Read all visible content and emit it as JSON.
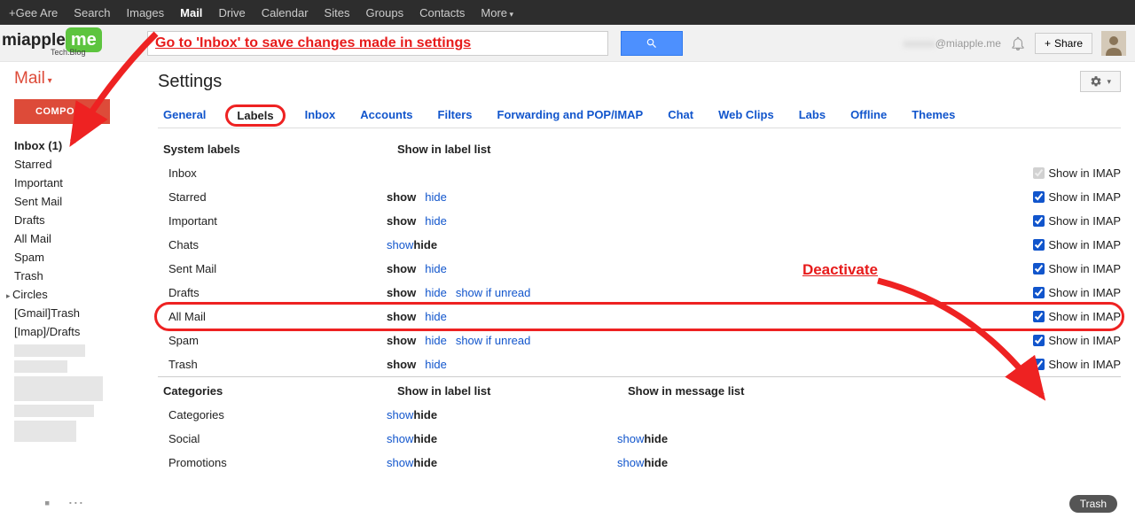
{
  "top_nav": {
    "items": [
      "+Gee Are",
      "Search",
      "Images",
      "Mail",
      "Drive",
      "Calendar",
      "Sites",
      "Groups",
      "Contacts",
      "More"
    ],
    "active_idx": 3
  },
  "logo": {
    "main": "miapple",
    "suffix": "me",
    "sub": "Tech.Blog"
  },
  "search": {
    "annotation": "Go to 'Inbox' to save changes made in settings"
  },
  "header": {
    "email_suffix": "@miapple.me",
    "share": "Share"
  },
  "sidebar": {
    "mail": "Mail",
    "compose": "COMPOSE",
    "items": [
      "Inbox (1)",
      "Starred",
      "Important",
      "Sent Mail",
      "Drafts",
      "All Mail",
      "Spam",
      "Trash",
      "Circles",
      "[Gmail]Trash",
      "[Imap]/Drafts"
    ]
  },
  "content": {
    "title": "Settings",
    "tabs": [
      "General",
      "Labels",
      "Inbox",
      "Accounts",
      "Filters",
      "Forwarding and POP/IMAP",
      "Chat",
      "Web Clips",
      "Labs",
      "Offline",
      "Themes"
    ],
    "active_tab_idx": 1,
    "section1": {
      "head_label": "System labels",
      "head_show": "Show in label list",
      "rows": [
        {
          "name": "Inbox",
          "showlist": [],
          "imap": true,
          "imap_disabled": true
        },
        {
          "name": "Starred",
          "showlist": [
            [
              "show",
              true
            ],
            [
              "hide",
              false
            ]
          ],
          "imap": true
        },
        {
          "name": "Important",
          "showlist": [
            [
              "show",
              true
            ],
            [
              "hide",
              false
            ]
          ],
          "imap": true
        },
        {
          "name": "Chats",
          "showlist": [
            [
              "show",
              false
            ],
            [
              "hide",
              true
            ]
          ],
          "imap": true
        },
        {
          "name": "Sent Mail",
          "showlist": [
            [
              "show",
              true
            ],
            [
              "hide",
              false
            ]
          ],
          "imap": true
        },
        {
          "name": "Drafts",
          "showlist": [
            [
              "show",
              true
            ],
            [
              "hide",
              false
            ],
            [
              "show if unread",
              false
            ]
          ],
          "imap": true
        },
        {
          "name": "All Mail",
          "showlist": [
            [
              "show",
              true
            ],
            [
              "hide",
              false
            ]
          ],
          "imap": true,
          "oval": true
        },
        {
          "name": "Spam",
          "showlist": [
            [
              "show",
              true
            ],
            [
              "hide",
              false
            ],
            [
              "show if unread",
              false
            ]
          ],
          "imap": true
        },
        {
          "name": "Trash",
          "showlist": [
            [
              "show",
              true
            ],
            [
              "hide",
              false
            ]
          ],
          "imap": true
        }
      ],
      "imap_label": "Show in IMAP"
    },
    "section2": {
      "head_label": "Categories",
      "head_show": "Show in label list",
      "head_msg": "Show in message list",
      "rows": [
        {
          "name": "Categories",
          "showlist": [
            [
              "show",
              false
            ],
            [
              "hide",
              true
            ]
          ],
          "msglist": []
        },
        {
          "name": "Social",
          "showlist": [
            [
              "show",
              false
            ],
            [
              "hide",
              true
            ]
          ],
          "msglist": [
            [
              "show",
              false
            ],
            [
              "hide",
              true
            ]
          ]
        },
        {
          "name": "Promotions",
          "showlist": [
            [
              "show",
              false
            ],
            [
              "hide",
              true
            ]
          ],
          "msglist": [
            [
              "show",
              false
            ],
            [
              "hide",
              true
            ]
          ]
        }
      ]
    },
    "annot_deactivate": "Deactivate",
    "pill": "Trash"
  }
}
